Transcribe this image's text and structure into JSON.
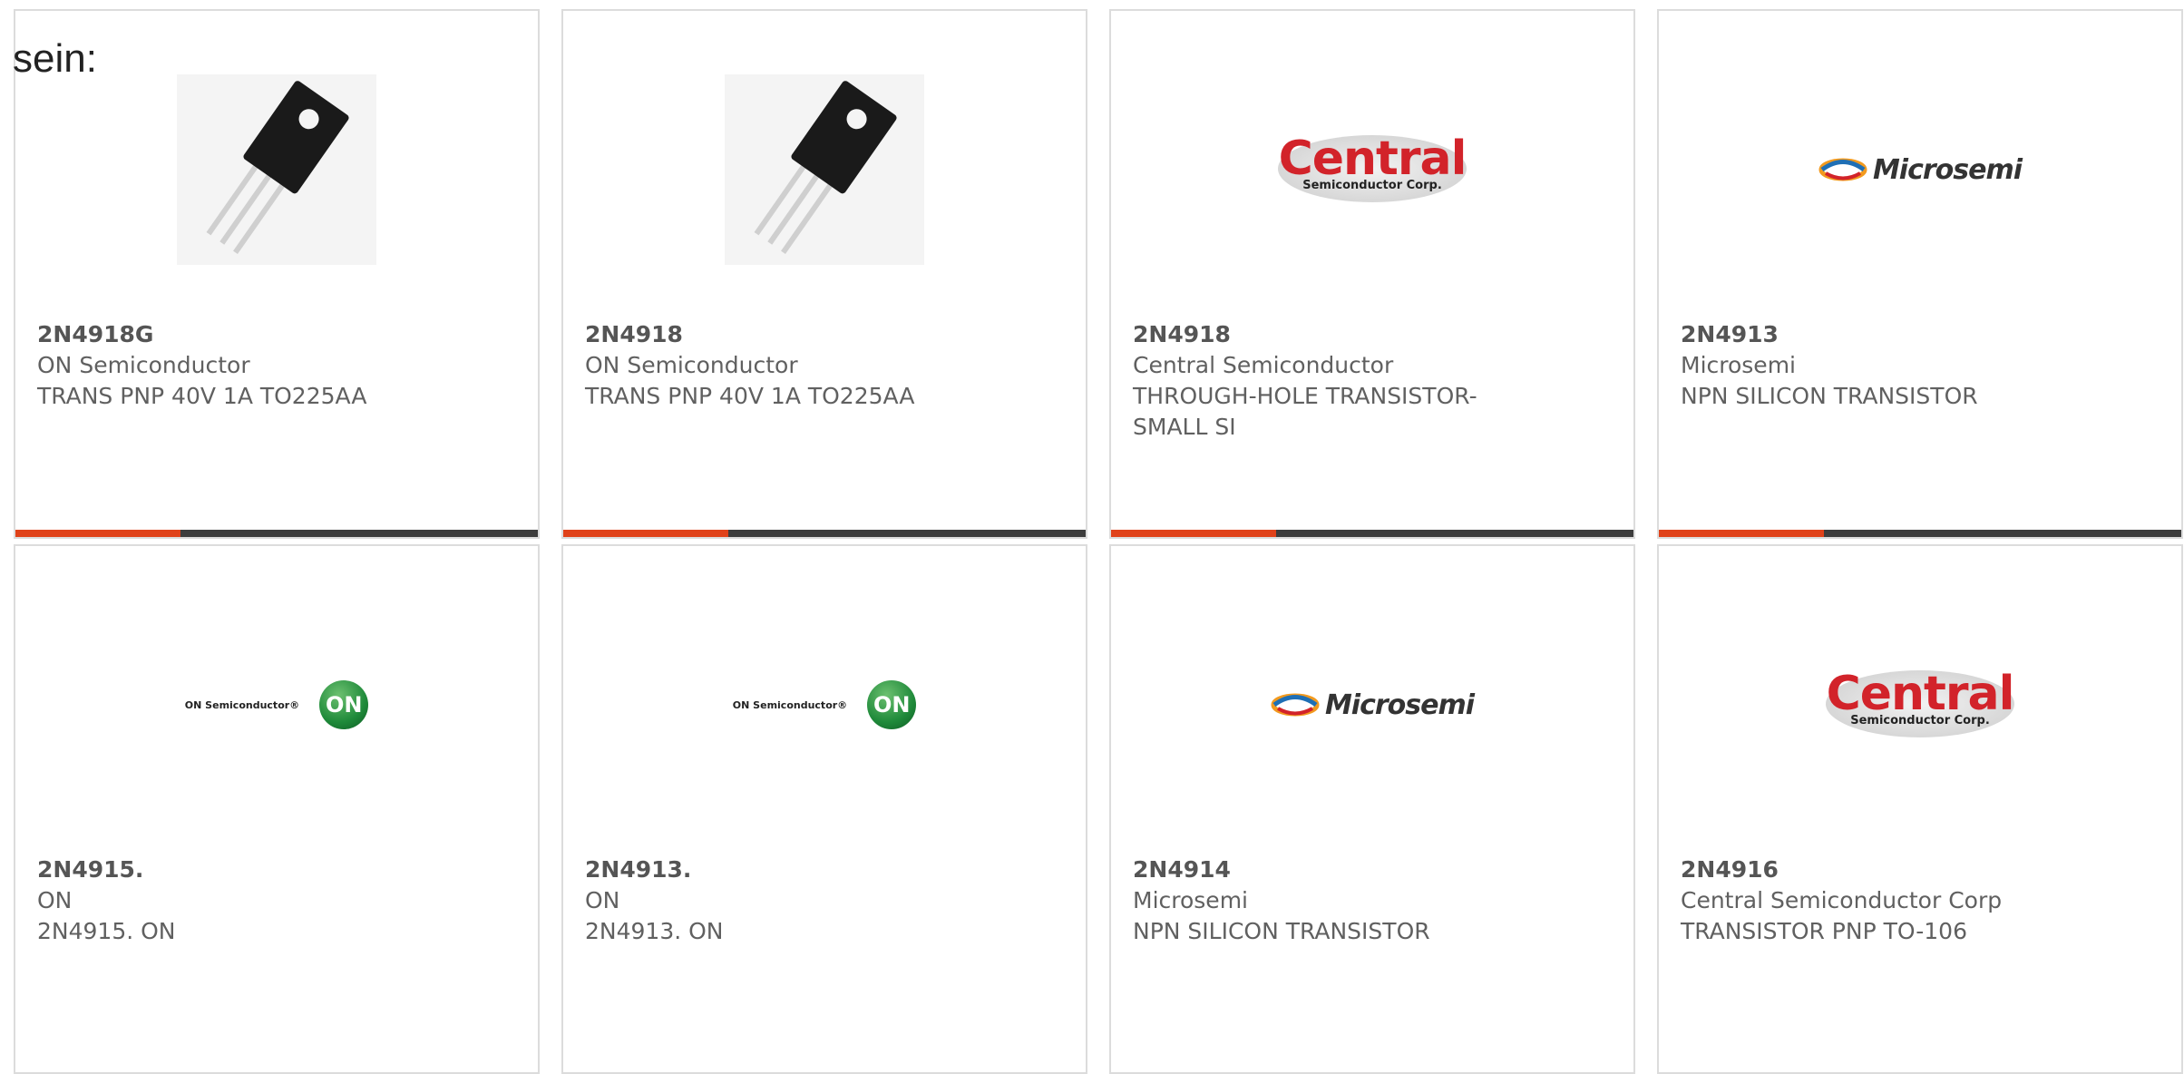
{
  "intro_text": "sein:",
  "cards": [
    {
      "part": "2N4918G",
      "manufacturer": "ON Semiconductor",
      "description": "TRANS PNP 40V 1A TO225AA",
      "image": "transistor-photo"
    },
    {
      "part": "2N4918",
      "manufacturer": "ON Semiconductor",
      "description": "TRANS PNP 40V 1A TO225AA",
      "image": "transistor-photo"
    },
    {
      "part": "2N4918",
      "manufacturer": "Central Semiconductor",
      "description": "THROUGH-HOLE TRANSISTOR-SMALL SI",
      "image": "central-logo",
      "logo": {
        "word": "Central",
        "sub": "Semiconductor Corp."
      }
    },
    {
      "part": "2N4913",
      "manufacturer": "Microsemi",
      "description": "NPN SILICON TRANSISTOR",
      "image": "microsemi-logo",
      "logo": {
        "word": "Microsemi"
      }
    },
    {
      "part": "2N4915.",
      "manufacturer": "ON",
      "description": "2N4915. ON",
      "image": "onsemi-logo",
      "logo": {
        "word": "ON Semiconductor®",
        "badge": "ON"
      }
    },
    {
      "part": "2N4913.",
      "manufacturer": "ON",
      "description": "2N4913. ON",
      "image": "onsemi-logo",
      "logo": {
        "word": "ON Semiconductor®",
        "badge": "ON"
      }
    },
    {
      "part": "2N4914",
      "manufacturer": "Microsemi",
      "description": "NPN SILICON TRANSISTOR",
      "image": "microsemi-logo",
      "logo": {
        "word": "Microsemi"
      }
    },
    {
      "part": "2N4916",
      "manufacturer": "Central Semiconductor Corp",
      "description": "TRANSISTOR PNP TO-106",
      "image": "central-logo",
      "logo": {
        "word": "Central",
        "sub": "Semiconductor Corp."
      }
    }
  ],
  "colors": {
    "accent": "#e0421a",
    "bar": "#3d3d3d",
    "border": "#dcdcdc"
  }
}
